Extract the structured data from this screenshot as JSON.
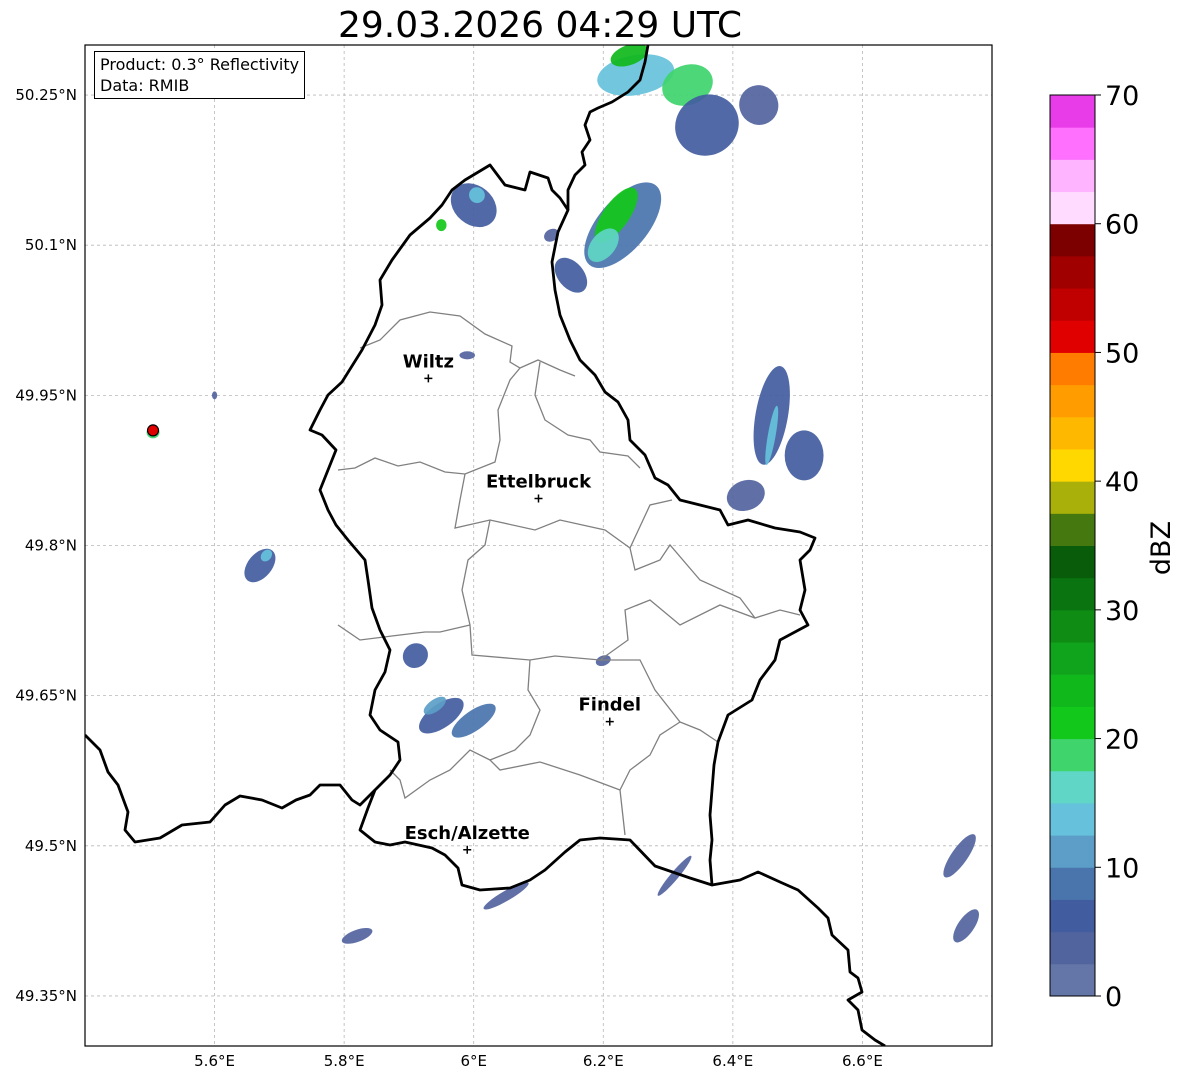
{
  "title": "29.03.2026 04:29 UTC",
  "info": {
    "product": "Product: 0.3° Reflectivity",
    "data": "Data: RMIB"
  },
  "map": {
    "lon_range": [
      5.4,
      6.8
    ],
    "lat_range": [
      49.3,
      50.3
    ],
    "lon_ticks": [
      5.6,
      5.8,
      6.0,
      6.2,
      6.4,
      6.6
    ],
    "lon_tick_labels": [
      "5.6°E",
      "5.8°E",
      "6°E",
      "6.2°E",
      "6.4°E",
      "6.6°E"
    ],
    "lat_ticks": [
      49.35,
      49.5,
      49.65,
      49.8,
      49.95,
      50.1,
      50.25
    ],
    "lat_tick_labels": [
      "49.35°N",
      "49.5°N",
      "49.65°N",
      "49.8°N",
      "49.95°N",
      "50.1°N",
      "50.25°N"
    ],
    "cities": [
      {
        "name": "Wiltz",
        "lon": 5.93,
        "lat": 49.967
      },
      {
        "name": "Ettelbruck",
        "lon": 6.1,
        "lat": 49.847
      },
      {
        "name": "Findel",
        "lon": 6.21,
        "lat": 49.624
      },
      {
        "name": "Esch/Alzette",
        "lon": 5.99,
        "lat": 49.496
      }
    ],
    "radar_site": {
      "lon": 5.505,
      "lat": 49.915,
      "color": "#e00000"
    }
  },
  "colorbar": {
    "label": "dBZ",
    "min": 0,
    "max": 70,
    "step": 2.5,
    "tick_values": [
      0,
      10,
      20,
      30,
      40,
      50,
      60,
      70
    ],
    "tick_labels": [
      "0",
      "10",
      "20",
      "30",
      "40",
      "50",
      "60",
      "70"
    ],
    "colors": [
      "#6476a8",
      "#52649e",
      "#425d9f",
      "#4a74ac",
      "#5c9ec8",
      "#66c2dc",
      "#5fd6c6",
      "#3fd46c",
      "#12c81a",
      "#10b81c",
      "#10a41c",
      "#0e8c14",
      "#0a7410",
      "#085c0a",
      "#467810",
      "#aab00a",
      "#ffd800",
      "#ffb800",
      "#ff9c00",
      "#ff7c00",
      "#e00000",
      "#c00000",
      "#a00000",
      "#7c0000",
      "#ffdcff",
      "#ffb4ff",
      "#ff70ff",
      "#e83ce8"
    ]
  },
  "radar_echoes": [
    {
      "lon": 6.25,
      "lat": 50.27,
      "rx": 0.06,
      "ry": 0.02,
      "angle": -10,
      "level": 12.5
    },
    {
      "lon": 6.33,
      "lat": 50.26,
      "rx": 0.04,
      "ry": 0.02,
      "angle": -20,
      "level": 17.5
    },
    {
      "lon": 6.36,
      "lat": 50.22,
      "rx": 0.05,
      "ry": 0.03,
      "angle": -30,
      "level": 5
    },
    {
      "lon": 6.44,
      "lat": 50.24,
      "rx": 0.03,
      "ry": 0.02,
      "angle": -30,
      "level": 2.5
    },
    {
      "lon": 6.24,
      "lat": 50.29,
      "rx": 0.03,
      "ry": 0.01,
      "angle": -20,
      "level": 22.5
    },
    {
      "lon": 6.23,
      "lat": 50.12,
      "rx": 0.08,
      "ry": 0.025,
      "angle": -50,
      "level": 7.5
    },
    {
      "lon": 6.22,
      "lat": 50.13,
      "rx": 0.05,
      "ry": 0.013,
      "angle": -55,
      "level": 20
    },
    {
      "lon": 6.2,
      "lat": 50.1,
      "rx": 0.03,
      "ry": 0.012,
      "angle": -50,
      "level": 15
    },
    {
      "lon": 6.15,
      "lat": 50.07,
      "rx": 0.02,
      "ry": 0.02,
      "angle": -40,
      "level": 5
    },
    {
      "lon": 6.0,
      "lat": 50.14,
      "rx": 0.03,
      "ry": 0.025,
      "angle": -50,
      "level": 5
    },
    {
      "lon": 6.005,
      "lat": 50.15,
      "rx": 0.012,
      "ry": 0.008,
      "angle": -50,
      "level": 12.5
    },
    {
      "lon": 5.95,
      "lat": 50.12,
      "rx": 0.008,
      "ry": 0.006,
      "angle": 0,
      "level": 20
    },
    {
      "lon": 6.12,
      "lat": 50.11,
      "rx": 0.012,
      "ry": 0.006,
      "angle": -30,
      "level": 2.5
    },
    {
      "lon": 6.46,
      "lat": 49.93,
      "rx": 0.025,
      "ry": 0.05,
      "angle": 10,
      "level": 5
    },
    {
      "lon": 6.46,
      "lat": 49.91,
      "rx": 0.006,
      "ry": 0.03,
      "angle": 10,
      "level": 12.5
    },
    {
      "lon": 6.51,
      "lat": 49.89,
      "rx": 0.03,
      "ry": 0.025,
      "angle": 0,
      "level": 5
    },
    {
      "lon": 6.42,
      "lat": 49.85,
      "rx": 0.03,
      "ry": 0.015,
      "angle": -20,
      "level": 2.5
    },
    {
      "lon": 5.67,
      "lat": 49.78,
      "rx": 0.03,
      "ry": 0.012,
      "angle": -50,
      "level": 5
    },
    {
      "lon": 5.68,
      "lat": 49.79,
      "rx": 0.01,
      "ry": 0.005,
      "angle": -50,
      "level": 12.5
    },
    {
      "lon": 5.91,
      "lat": 49.69,
      "rx": 0.02,
      "ry": 0.012,
      "angle": -40,
      "level": 5
    },
    {
      "lon": 5.95,
      "lat": 49.63,
      "rx": 0.04,
      "ry": 0.012,
      "angle": -35,
      "level": 5
    },
    {
      "lon": 6.0,
      "lat": 49.625,
      "rx": 0.04,
      "ry": 0.01,
      "angle": -35,
      "level": 7.5
    },
    {
      "lon": 5.94,
      "lat": 49.64,
      "rx": 0.02,
      "ry": 0.006,
      "angle": -35,
      "level": 10
    },
    {
      "lon": 5.505,
      "lat": 49.913,
      "rx": 0.01,
      "ry": 0.006,
      "angle": 0,
      "level": 17.5
    },
    {
      "lon": 6.2,
      "lat": 49.685,
      "rx": 0.012,
      "ry": 0.005,
      "angle": -20,
      "level": 2.5
    },
    {
      "lon": 6.75,
      "lat": 49.49,
      "rx": 0.04,
      "ry": 0.008,
      "angle": -55,
      "level": 2.5
    },
    {
      "lon": 6.76,
      "lat": 49.42,
      "rx": 0.03,
      "ry": 0.008,
      "angle": -55,
      "level": 2.5
    },
    {
      "lon": 5.82,
      "lat": 49.41,
      "rx": 0.025,
      "ry": 0.006,
      "angle": -20,
      "level": 2.5
    },
    {
      "lon": 6.05,
      "lat": 49.45,
      "rx": 0.04,
      "ry": 0.005,
      "angle": -30,
      "level": 2.5
    },
    {
      "lon": 6.31,
      "lat": 49.47,
      "rx": 0.04,
      "ry": 0.004,
      "angle": -50,
      "level": 2.5
    },
    {
      "lon": 5.99,
      "lat": 49.99,
      "rx": 0.012,
      "ry": 0.004,
      "angle": 0,
      "level": 2.5
    },
    {
      "lon": 5.6,
      "lat": 49.95,
      "rx": 0.004,
      "ry": 0.004,
      "angle": 0,
      "level": 2.5
    }
  ]
}
